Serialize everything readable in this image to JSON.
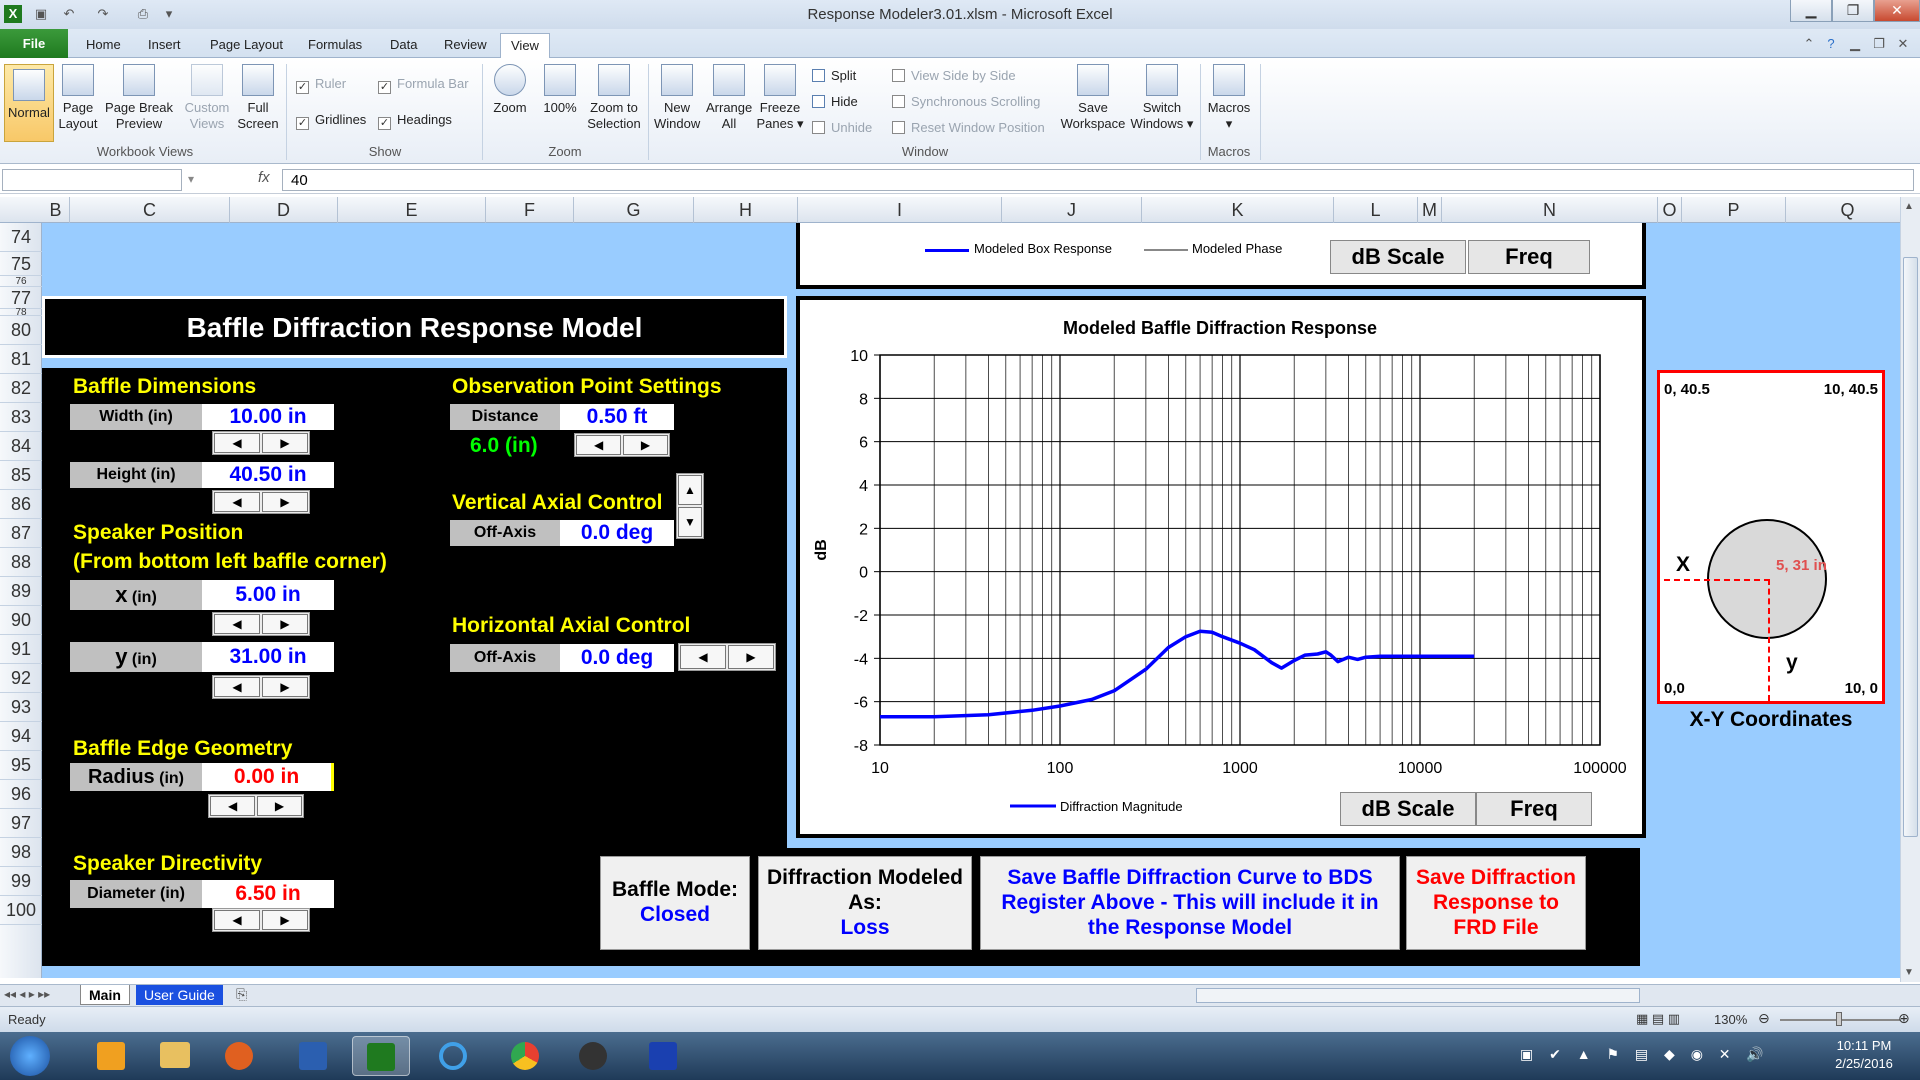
{
  "window": {
    "title": "Response Modeler3.01.xlsm - Microsoft Excel"
  },
  "tabs": [
    "File",
    "Home",
    "Insert",
    "Page Layout",
    "Formulas",
    "Data",
    "Review",
    "View"
  ],
  "ribbon": {
    "workbook_views": {
      "label": "Workbook Views",
      "items": [
        "Normal",
        "Page Layout",
        "Page Break Preview",
        "Custom Views",
        "Full Screen"
      ]
    },
    "show": {
      "label": "Show",
      "ruler": "Ruler",
      "formula_bar": "Formula Bar",
      "gridlines": "Gridlines",
      "headings": "Headings"
    },
    "zoom": {
      "label": "Zoom",
      "items": [
        "Zoom",
        "100%",
        "Zoom to Selection"
      ]
    },
    "window": {
      "label": "Window",
      "new_window": "New Window",
      "arrange_all": "Arrange All",
      "freeze_panes": "Freeze Panes",
      "split": "Split",
      "hide": "Hide",
      "unhide": "Unhide",
      "view_side": "View Side by Side",
      "sync_scroll": "Synchronous Scrolling",
      "reset_pos": "Reset Window Position",
      "save_ws": "Save Workspace",
      "switch_windows": "Switch Windows"
    },
    "macros": {
      "label": "Macros",
      "item": "Macros"
    }
  },
  "formula": {
    "fx": "fx",
    "value": "40"
  },
  "columns": [
    "B",
    "C",
    "D",
    "E",
    "F",
    "G",
    "H",
    "I",
    "J",
    "K",
    "L",
    "M",
    "N",
    "O",
    "P",
    "Q"
  ],
  "rows": [
    "74",
    "75",
    "76",
    "77",
    "78",
    "80",
    "81",
    "82",
    "83",
    "84",
    "85",
    "86",
    "87",
    "88",
    "89",
    "90",
    "91",
    "92",
    "93",
    "94",
    "95",
    "96",
    "97",
    "98",
    "99",
    "100"
  ],
  "model": {
    "title": "Baffle Diffraction Response Model",
    "baffle_dimensions": "Baffle Dimensions",
    "width_label": "Width (in)",
    "width_value": "10.00 in",
    "height_label": "Height (in)",
    "height_value": "40.50 in",
    "speaker_position": "Speaker Position",
    "from_corner": "(From bottom left baffle corner)",
    "x_label": "x",
    "x_unit": "(in)",
    "x_value": "5.00 in",
    "y_label": "y",
    "y_unit": "(in)",
    "y_value": "31.00 in",
    "edge_geometry": "Baffle Edge Geometry",
    "radius_label": "Radius",
    "radius_unit": "(in)",
    "radius_value": "0.00 in",
    "directivity": "Speaker Directivity",
    "diameter_label": "Diameter (in)",
    "diameter_value": "6.50 in",
    "obs_settings": "Observation Point Settings",
    "distance_label": "Distance",
    "distance_value": "0.50 ft",
    "distance_in": "6.0 (in)",
    "vertical_axial": "Vertical Axial Control",
    "vert_offaxis_label": "Off-Axis",
    "vert_offaxis_value": "0.0 deg",
    "horizontal_axial": "Horizontal Axial Control",
    "horiz_offaxis_label": "Off-Axis",
    "horiz_offaxis_value": "0.0 deg"
  },
  "top_chart": {
    "legend_box": "Modeled Box Response",
    "legend_phase": "Modeled Phase",
    "btn_db": "dB Scale",
    "btn_freq": "Freq"
  },
  "chart_data": {
    "type": "line",
    "title": "Modeled Baffle Diffraction Response",
    "xlabel": "",
    "ylabel": "dB",
    "xscale": "log",
    "xlim": [
      10,
      100000
    ],
    "ylim": [
      -8,
      10
    ],
    "xticks": [
      "10",
      "100",
      "1000",
      "10000",
      "100000"
    ],
    "yticks": [
      "10",
      "8",
      "6",
      "4",
      "2",
      "0",
      "-2",
      "-4",
      "-6",
      "-8"
    ],
    "grid": true,
    "legend": "bottom-center",
    "series": [
      {
        "name": "Diffraction Magnitude",
        "color": "#0000ff",
        "x": [
          10,
          20,
          40,
          70,
          100,
          150,
          200,
          300,
          400,
          500,
          600,
          700,
          800,
          1000,
          1200,
          1500,
          1700,
          2000,
          2300,
          2700,
          3000,
          3200,
          3500,
          4000,
          4500,
          5000,
          6000,
          8000,
          10000,
          15000,
          20000
        ],
        "y": [
          -6.7,
          -6.7,
          -6.6,
          -6.4,
          -6.2,
          -5.9,
          -5.5,
          -4.5,
          -3.5,
          -3.0,
          -2.75,
          -2.8,
          -3.0,
          -3.3,
          -3.6,
          -4.2,
          -4.45,
          -4.1,
          -3.85,
          -3.8,
          -3.7,
          -3.85,
          -4.15,
          -3.95,
          -4.05,
          -3.95,
          -3.9,
          -3.9,
          -3.9,
          -3.9,
          -3.9
        ]
      }
    ]
  },
  "bottom_chart": {
    "btn_db": "dB Scale",
    "btn_freq": "Freq"
  },
  "bottom_buttons": {
    "mode_label": "Baffle Mode:",
    "mode_value": "Closed",
    "modeled_label": "Diffraction Modeled As:",
    "modeled_value": "Loss",
    "save_bds": "Save Baffle Diffraction Curve to BDS Register Above - This will include it in the Response Model",
    "save_frd": "Save Diffraction Response to FRD File"
  },
  "xy": {
    "tl": "0, 40.5",
    "tr": "10, 40.5",
    "bl": "0,0",
    "br": "10, 0",
    "x": "X",
    "y": "y",
    "point": "5, 31 in",
    "caption": "X-Y Coordinates"
  },
  "sheets": {
    "main": "Main",
    "guide": "User Guide"
  },
  "status": {
    "ready": "Ready",
    "zoom": "130%"
  },
  "clock": {
    "time": "10:11 PM",
    "date": "2/25/2016"
  }
}
